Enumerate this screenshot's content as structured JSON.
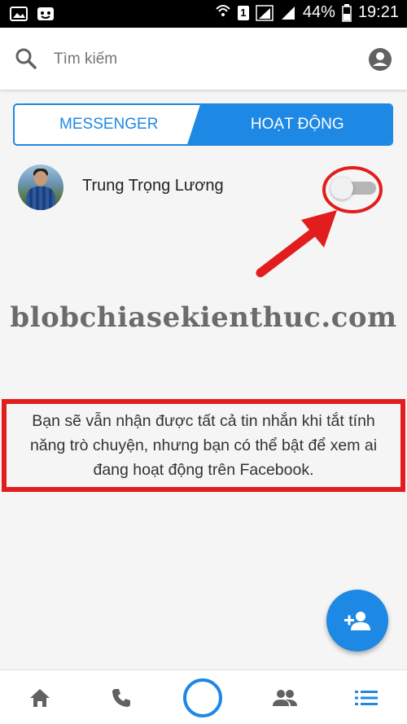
{
  "status_bar": {
    "battery": "44%",
    "time": "19:21",
    "sim_slot": "1"
  },
  "search": {
    "placeholder": "Tìm kiếm"
  },
  "tabs": [
    {
      "label": "MESSENGER",
      "active": false
    },
    {
      "label": "HOẠT ĐỘNG",
      "active": true
    }
  ],
  "contact": {
    "name": "Trung Trọng Lương",
    "active_status_enabled": false
  },
  "watermark": "blobchiasekienthuc.com",
  "info_text": "Bạn sẽ vẫn nhận được tất cả tin nhắn khi tắt tính năng trò chuyện, nhưng bạn có thể bật để xem ai đang hoạt động trên Facebook.",
  "bottom_nav": [
    "home-icon",
    "phone-icon",
    "camera-icon",
    "people-icon",
    "list-icon"
  ],
  "colors": {
    "accent": "#1e88e5",
    "annotation": "#e21d1d"
  }
}
